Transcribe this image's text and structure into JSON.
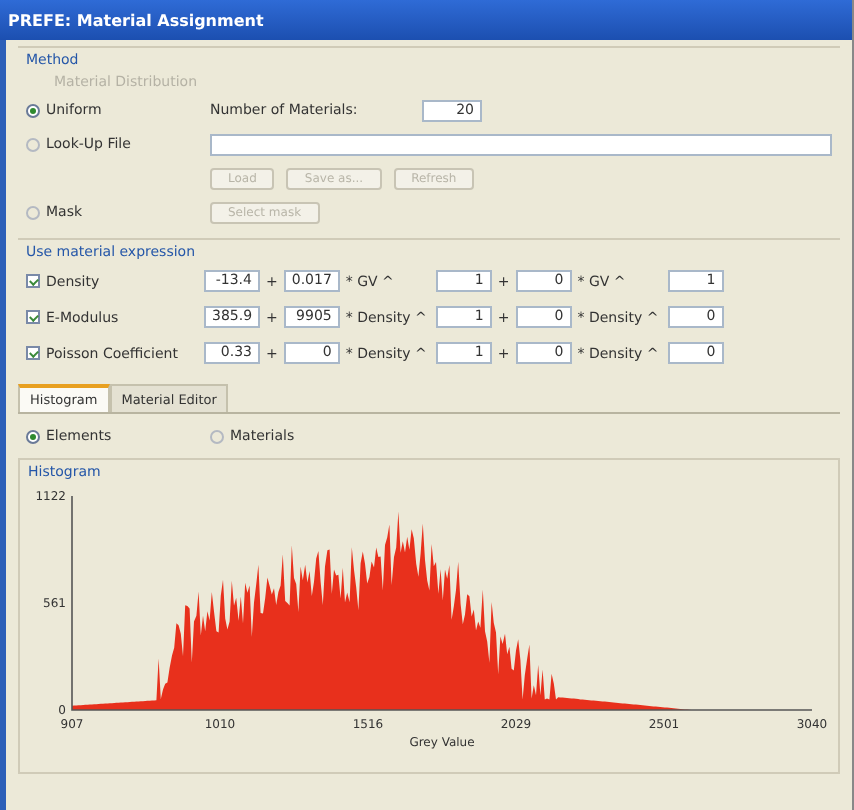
{
  "window": {
    "title": "PREFE: Material Assignment"
  },
  "method": {
    "title": "Method",
    "subtitle": "Material Distribution",
    "options": [
      {
        "label": "Uniform",
        "selected": true
      },
      {
        "label": "Look-Up File",
        "selected": false
      },
      {
        "label": "Mask",
        "selected": false
      }
    ],
    "materials_label": "Number of Materials:",
    "materials_value": "20",
    "file_buttons": [
      {
        "label": "Load",
        "disabled": true
      },
      {
        "label": "Save as...",
        "disabled": true
      },
      {
        "label": "Refresh",
        "disabled": true
      }
    ],
    "mask_button": {
      "label": "Select mask",
      "disabled": true
    }
  },
  "expression": {
    "title": "Use material expression",
    "rows": [
      {
        "label": "Density",
        "checked": true,
        "a": "-13.4",
        "p1": "+",
        "p2": "+",
        "b": "0.017",
        "t1": "* GV ^",
        "c": "1",
        "d": "0",
        "t2": "* GV ^",
        "e": "1"
      },
      {
        "label": "E-Modulus",
        "checked": true,
        "a": "385.9",
        "p1": "+",
        "p2": "+",
        "b": "9905",
        "t1": "* Density ^",
        "c": "1",
        "d": "0",
        "t2": "* Density ^",
        "e": "0"
      },
      {
        "label": "Poisson Coefficient",
        "checked": true,
        "a": "0.33",
        "p1": "+",
        "p2": "+",
        "b": "0",
        "t1": "* Density ^",
        "c": "1",
        "d": "0",
        "t2": "* Density ^",
        "e": "0"
      }
    ]
  },
  "tabs": [
    {
      "label": "Histogram",
      "selected": true
    },
    {
      "label": "Material Editor",
      "selected": false
    }
  ],
  "count_by": [
    {
      "label": "Elements",
      "selected": true
    },
    {
      "label": "Materials",
      "selected": false
    }
  ],
  "histogram": {
    "title": "Histogram",
    "yticks": [
      "1122",
      "561",
      "0"
    ],
    "xticks": [
      "907",
      "1010",
      "1516",
      "2029",
      "2501",
      "3040"
    ],
    "xlabel": "Grey Value"
  }
}
